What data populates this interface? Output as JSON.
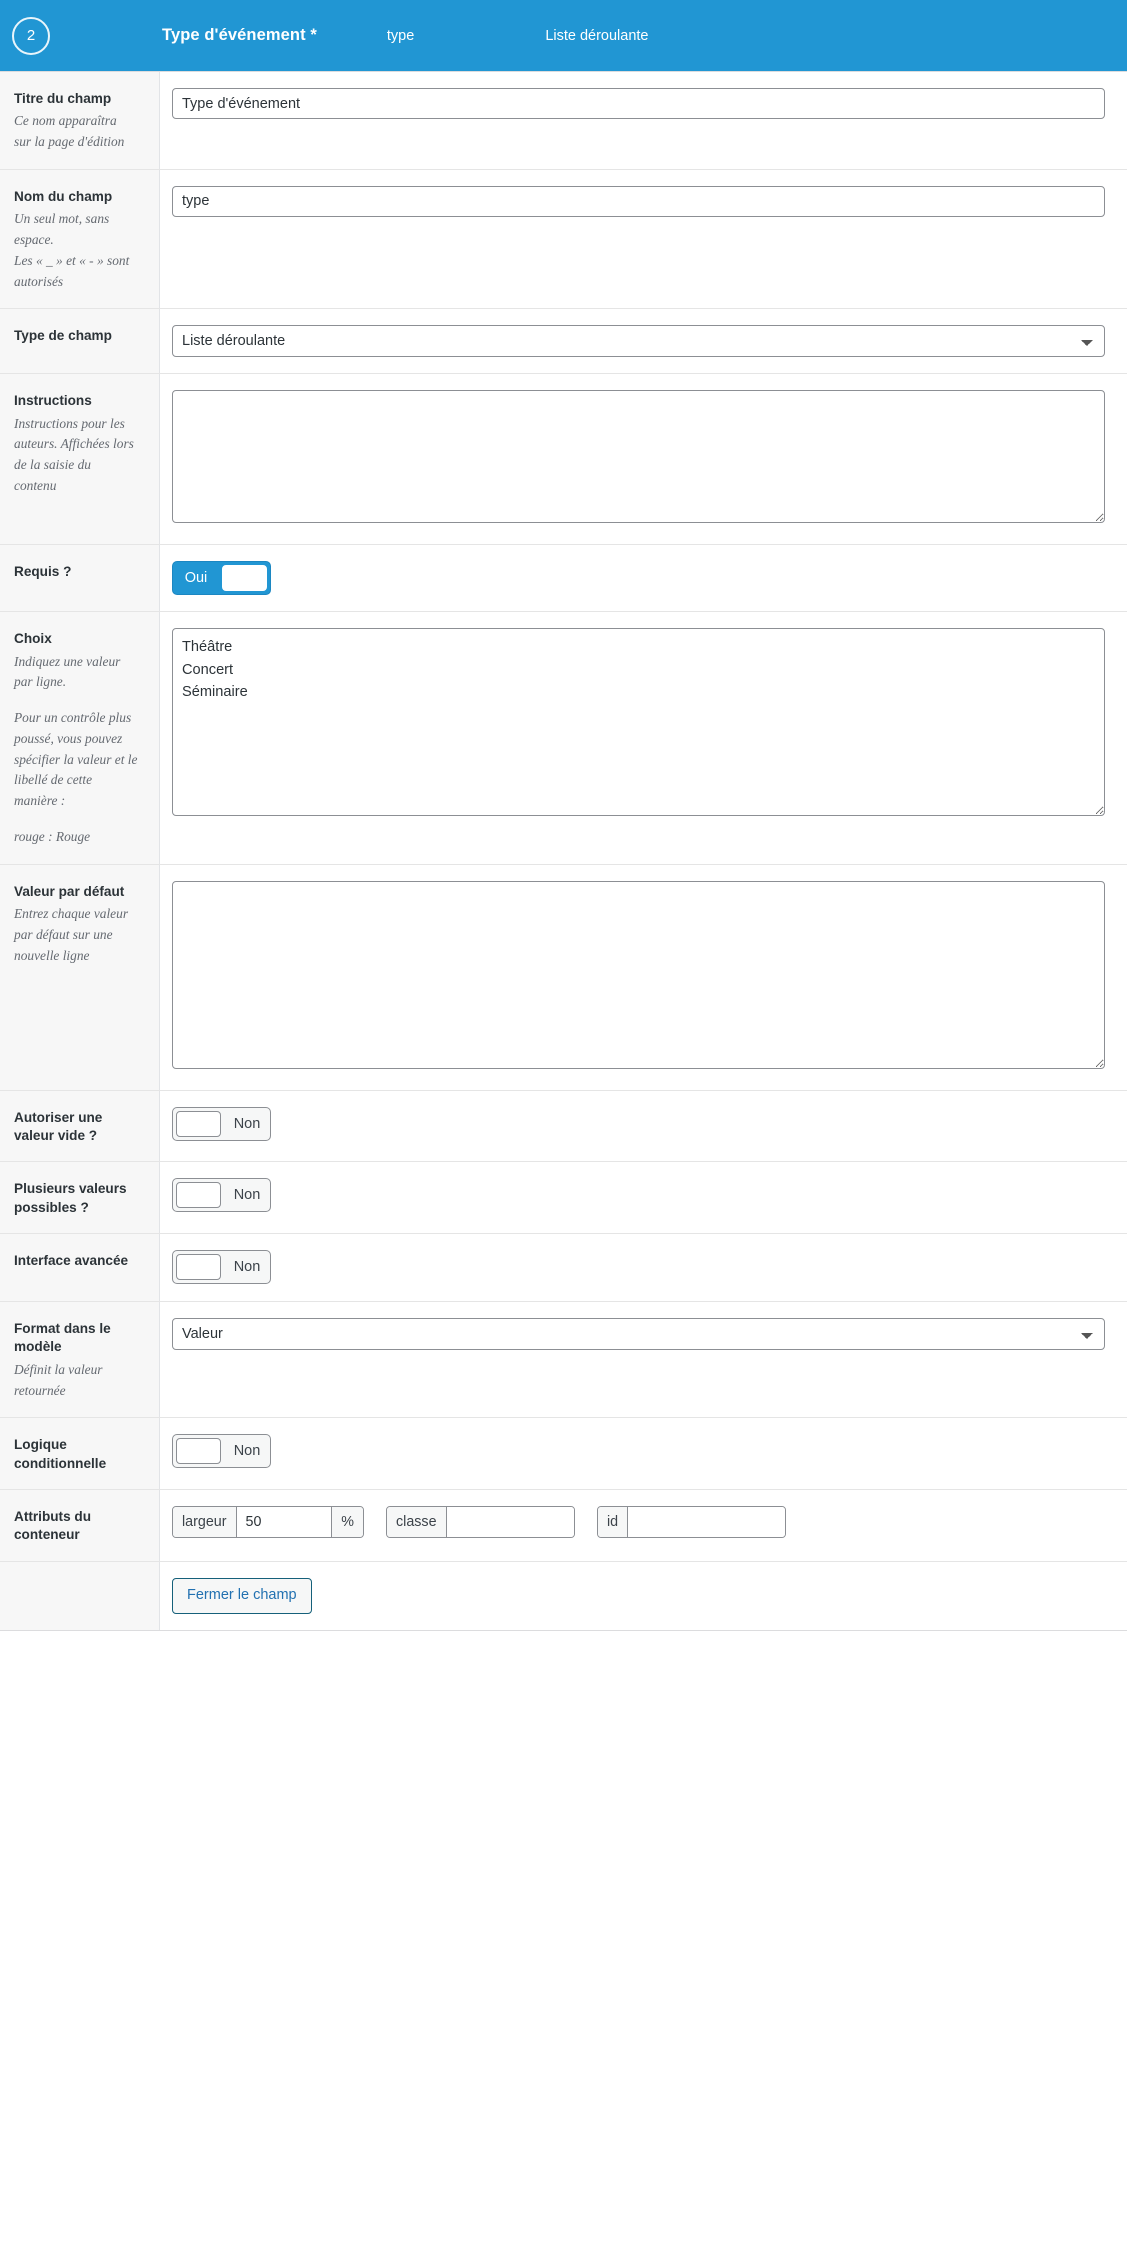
{
  "header": {
    "order": "2",
    "label": "Type d'événement *",
    "name": "type",
    "type": "Liste déroulante"
  },
  "colors": {
    "accent": "#2196d3",
    "label_bg": "#f7f7f7",
    "border": "#8c8f94",
    "link": "#2271b1"
  },
  "rows": {
    "field_label": {
      "title": "Titre du champ",
      "desc_line1": "Ce nom apparaîtra",
      "desc_line2": "sur la page d'édition",
      "value": "Type d'événement"
    },
    "field_name": {
      "title": "Nom du champ",
      "desc_line1": "Un seul mot, sans",
      "desc_line2": "espace.",
      "desc_line3": "Les « _ » et « - » sont",
      "desc_line4": "autorisés",
      "value": "type"
    },
    "field_type": {
      "title": "Type de champ",
      "value": "Liste déroulante",
      "options": [
        "Liste déroulante"
      ]
    },
    "instructions": {
      "title": "Instructions",
      "desc_line1": "Instructions pour les",
      "desc_line2": "auteurs. Affichées lors",
      "desc_line3": "de la saisie du",
      "desc_line4": "contenu",
      "value": ""
    },
    "required": {
      "title": "Requis ?",
      "state": "Oui"
    },
    "choices": {
      "title": "Choix",
      "desc_line1": "Indiquez une valeur",
      "desc_line2": "par ligne.",
      "desc_line3": "Pour un contrôle plus",
      "desc_line4": "poussé, vous pouvez",
      "desc_line5": "spécifier la valeur et le",
      "desc_line6": "libellé de cette",
      "desc_line7": "manière :",
      "desc_line8": "rouge : Rouge",
      "value": "Théâtre\nConcert\nSéminaire"
    },
    "default_value": {
      "title": "Valeur par défaut",
      "desc_line1": "Entrez chaque valeur",
      "desc_line2": "par défaut sur une",
      "desc_line3": "nouvelle ligne",
      "value": ""
    },
    "allow_null": {
      "title": "Autoriser une valeur vide ?",
      "state": "Non"
    },
    "multiple": {
      "title": "Plusieurs valeurs possibles ?",
      "state": "Non"
    },
    "advanced_ui": {
      "title": "Interface avancée",
      "state": "Non"
    },
    "return_format": {
      "title": "Format dans le modèle",
      "desc_line1": "Définit la valeur",
      "desc_line2": "retournée",
      "value": "Valeur",
      "options": [
        "Valeur"
      ]
    },
    "conditional_logic": {
      "title": "Logique conditionnelle",
      "state": "Non"
    },
    "wrapper_attributes": {
      "title": "Attributs du conteneur",
      "width_prepend": "largeur",
      "width_value": "50",
      "width_append": "%",
      "class_prepend": "classe",
      "class_value": "",
      "id_prepend": "id",
      "id_value": ""
    },
    "actions": {
      "close_label": "Fermer le champ"
    }
  }
}
